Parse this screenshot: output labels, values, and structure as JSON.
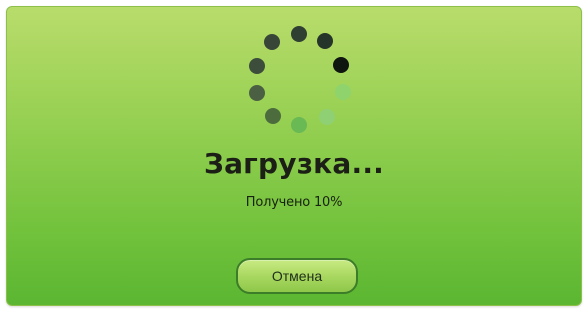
{
  "dialog": {
    "title": "Загрузка...",
    "status_text": "Получено 10%",
    "progress_percent": 10,
    "cancel_label": "Отмена"
  },
  "colors": {
    "background_top": "#b9dc6b",
    "background_bottom": "#5bb631",
    "button_border": "#3c7d29"
  },
  "icons": {
    "spinner": "loading-spinner-icon"
  }
}
